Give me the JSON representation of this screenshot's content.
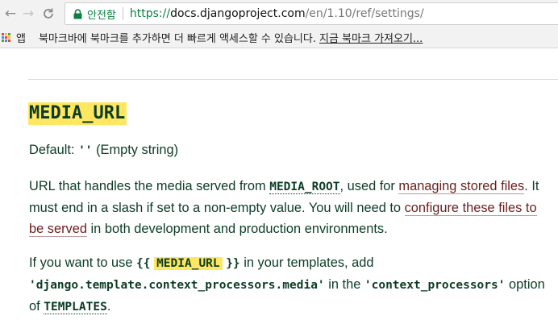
{
  "browser": {
    "secure_label": "안전함",
    "url_scheme": "https://",
    "url_host": "docs.djangoproject.com",
    "url_path": "/en/1.10/ref/settings/"
  },
  "bookmarks_bar": {
    "apps_label": "앱",
    "message": "북마크바에 북마크를 추가하면 더 빠르게 액세스할 수 있습니다.",
    "import_link": "지금 북마크 가져오기..."
  },
  "doc": {
    "title": "MEDIA_URL",
    "default": {
      "label": "Default:",
      "value": "''",
      "note": "(Empty string)"
    },
    "description": {
      "t1": "URL that handles the media served from ",
      "code1": "MEDIA_ROOT",
      "t2": ", used for ",
      "link1": "managing stored files",
      "t3": ". It must end in a slash if set to a non-empty value. You will need to ",
      "link2": "configure these files to be served",
      "t4": " in both development and production environments."
    },
    "usage": {
      "t1": "If you want to use ",
      "code_open": "{{",
      "code_var": "MEDIA_URL",
      "code_close": "}}",
      "t2": " in your templates, add ",
      "code2": "'django.template.context_processors.media'",
      "t3": " in the ",
      "code3": "'context_processors'",
      "t4": " option of ",
      "code4": "TEMPLATES",
      "t5": "."
    }
  }
}
